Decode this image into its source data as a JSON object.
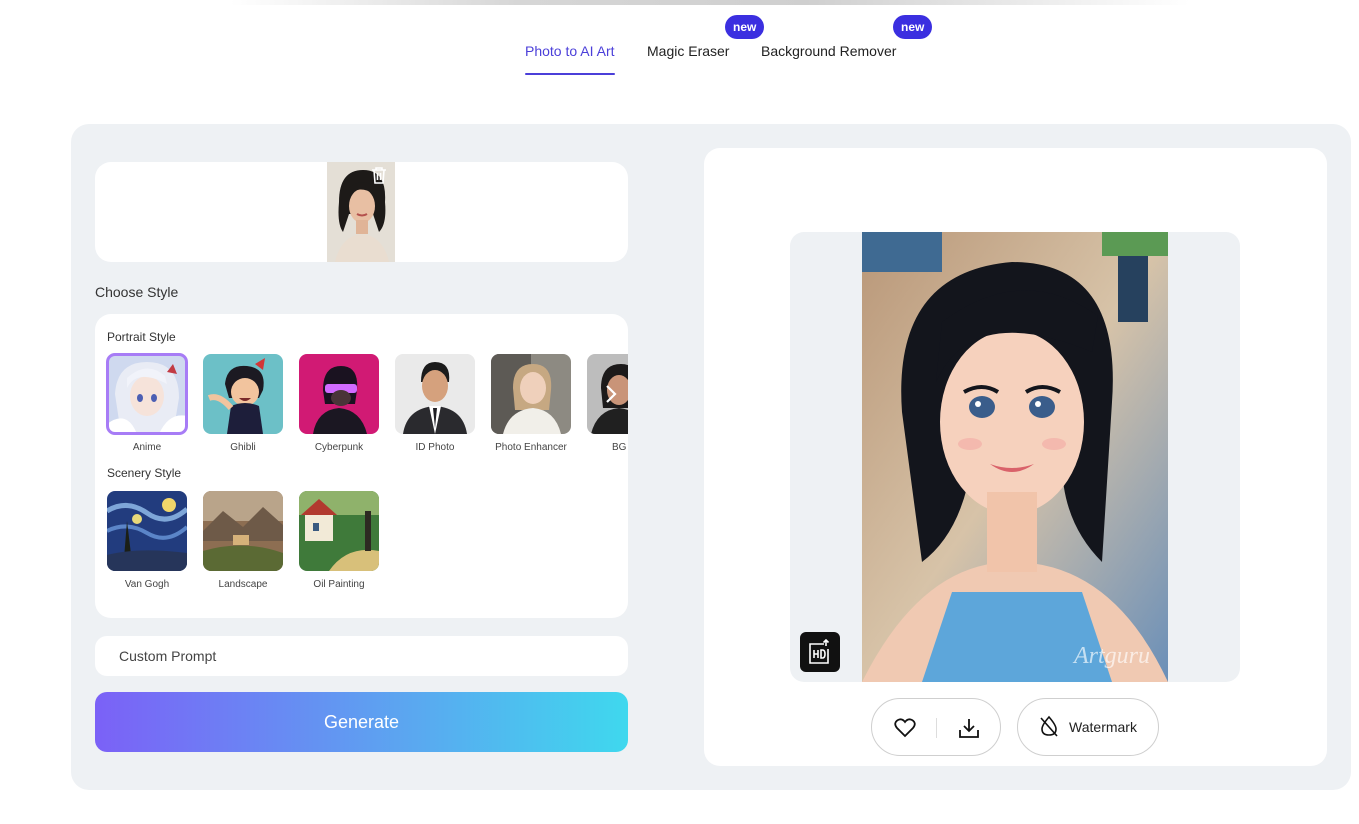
{
  "tabs": [
    {
      "label": "Photo to AI Art",
      "active": true,
      "badge": ""
    },
    {
      "label": "Magic Eraser",
      "active": false,
      "badge": "new"
    },
    {
      "label": "Background Remover",
      "active": false,
      "badge": "new"
    }
  ],
  "upload": {
    "delete_icon": "trash-icon"
  },
  "choose_style_label": "Choose Style",
  "portrait_section": {
    "label": "Portrait Style",
    "items": [
      {
        "name": "Anime",
        "selected": true
      },
      {
        "name": "Ghibli",
        "selected": false
      },
      {
        "name": "Cyberpunk",
        "selected": false
      },
      {
        "name": "ID Photo",
        "selected": false
      },
      {
        "name": "Photo Enhancer",
        "selected": false
      },
      {
        "name": "BG Re",
        "selected": false
      }
    ]
  },
  "scenery_section": {
    "label": "Scenery Style",
    "items": [
      {
        "name": "Van Gogh"
      },
      {
        "name": "Landscape"
      },
      {
        "name": "Oil Painting"
      }
    ]
  },
  "prompt": {
    "placeholder": "Custom Prompt",
    "value": ""
  },
  "generate_label": "Generate",
  "result": {
    "watermark_overlay": "Artguru",
    "watermark_button_label": "Watermark"
  },
  "colors": {
    "accent": "#4b3fd9",
    "badge": "#3b2fe0",
    "panel_bg": "#eef1f4",
    "selected_outline": "#a77cf6"
  }
}
